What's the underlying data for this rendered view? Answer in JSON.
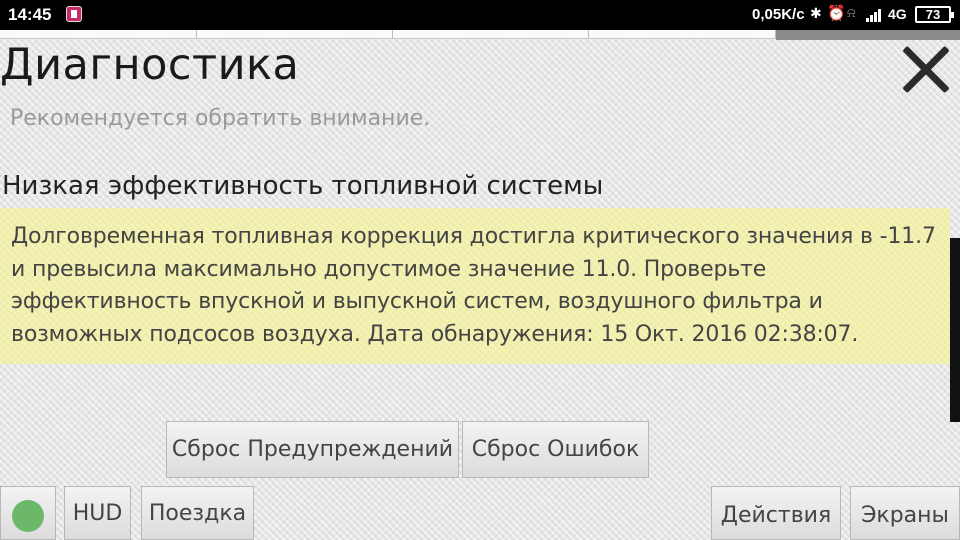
{
  "status_bar": {
    "time": "14:45",
    "network_speed": "0,05K/c",
    "network_type": "4G",
    "battery": "73"
  },
  "header": {
    "title": "Диагностика",
    "subtitle": "Рекомендуется обратить внимание."
  },
  "issue": {
    "title": "Низкая эффективность топливной системы",
    "description": "Долговременная топливная коррекция достигла критического значения в -11.7 и превысила максимально допустимое значение 11.0. Проверьте эффективность впускной и выпускной систем, воздушного фильтра и возможных подсосов воздуха. Дата обнаружения: 15 Окт. 2016 02:38:07.",
    "highlight_color": "#f6f48c"
  },
  "actions": {
    "reset_warnings": "Сброс Предупреждений",
    "reset_errors": "Сброс Ошибок"
  },
  "bottom_bar": {
    "indicator_color": "#6bb86b",
    "hud": "HUD",
    "trip": "Поездка",
    "actions": "Действия",
    "screens": "Экраны"
  }
}
